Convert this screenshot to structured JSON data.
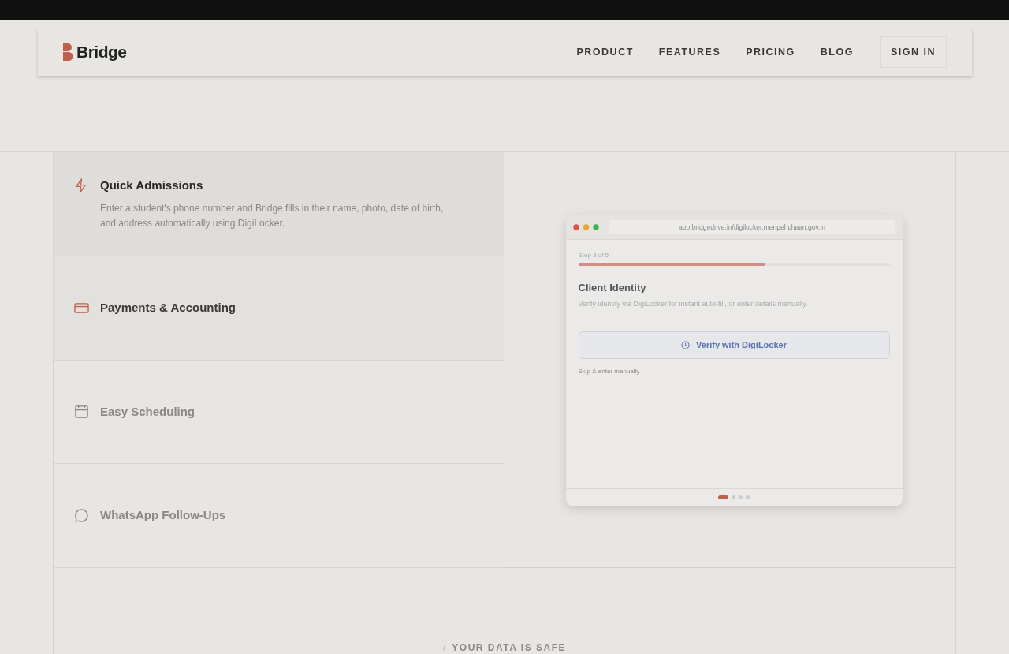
{
  "navbar": {
    "brand": "Bridge",
    "links": [
      "PRODUCT",
      "FEATURES",
      "PRICING",
      "BLOG"
    ],
    "sign_in": "SIGN IN"
  },
  "features": [
    {
      "kind": "bolt",
      "title": "Quick Admissions",
      "description": "Enter a student's phone number and Bridge fills in their name, photo, date of birth, and address automatically using DigiLocker.",
      "selected": true,
      "hovered": false
    },
    {
      "kind": "card",
      "title": "Payments & Accounting",
      "selected": false,
      "hovered": true
    },
    {
      "kind": "calendar",
      "title": "Easy Scheduling",
      "selected": false,
      "hovered": false
    },
    {
      "kind": "chat",
      "title": "WhatsApp Follow-Ups",
      "selected": false,
      "hovered": false
    }
  ],
  "preview": {
    "url": "app.bridgedrive.in/digilocker.meripehchaan.gov.in",
    "step": "Step 3 of 5",
    "level": 0.6,
    "title": "Client Identity",
    "subtitle": "Verify identity via DigiLocker for instant auto-fill, or enter details manually.",
    "button": "Verify with DigiLocker",
    "skip": "Skip & enter manually",
    "dots": [
      {
        "selected": true
      },
      {
        "selected": false
      },
      {
        "selected": false
      },
      {
        "selected": false
      }
    ]
  },
  "section_mark": "/",
  "section_label": "YOUR DATA IS SAFE"
}
